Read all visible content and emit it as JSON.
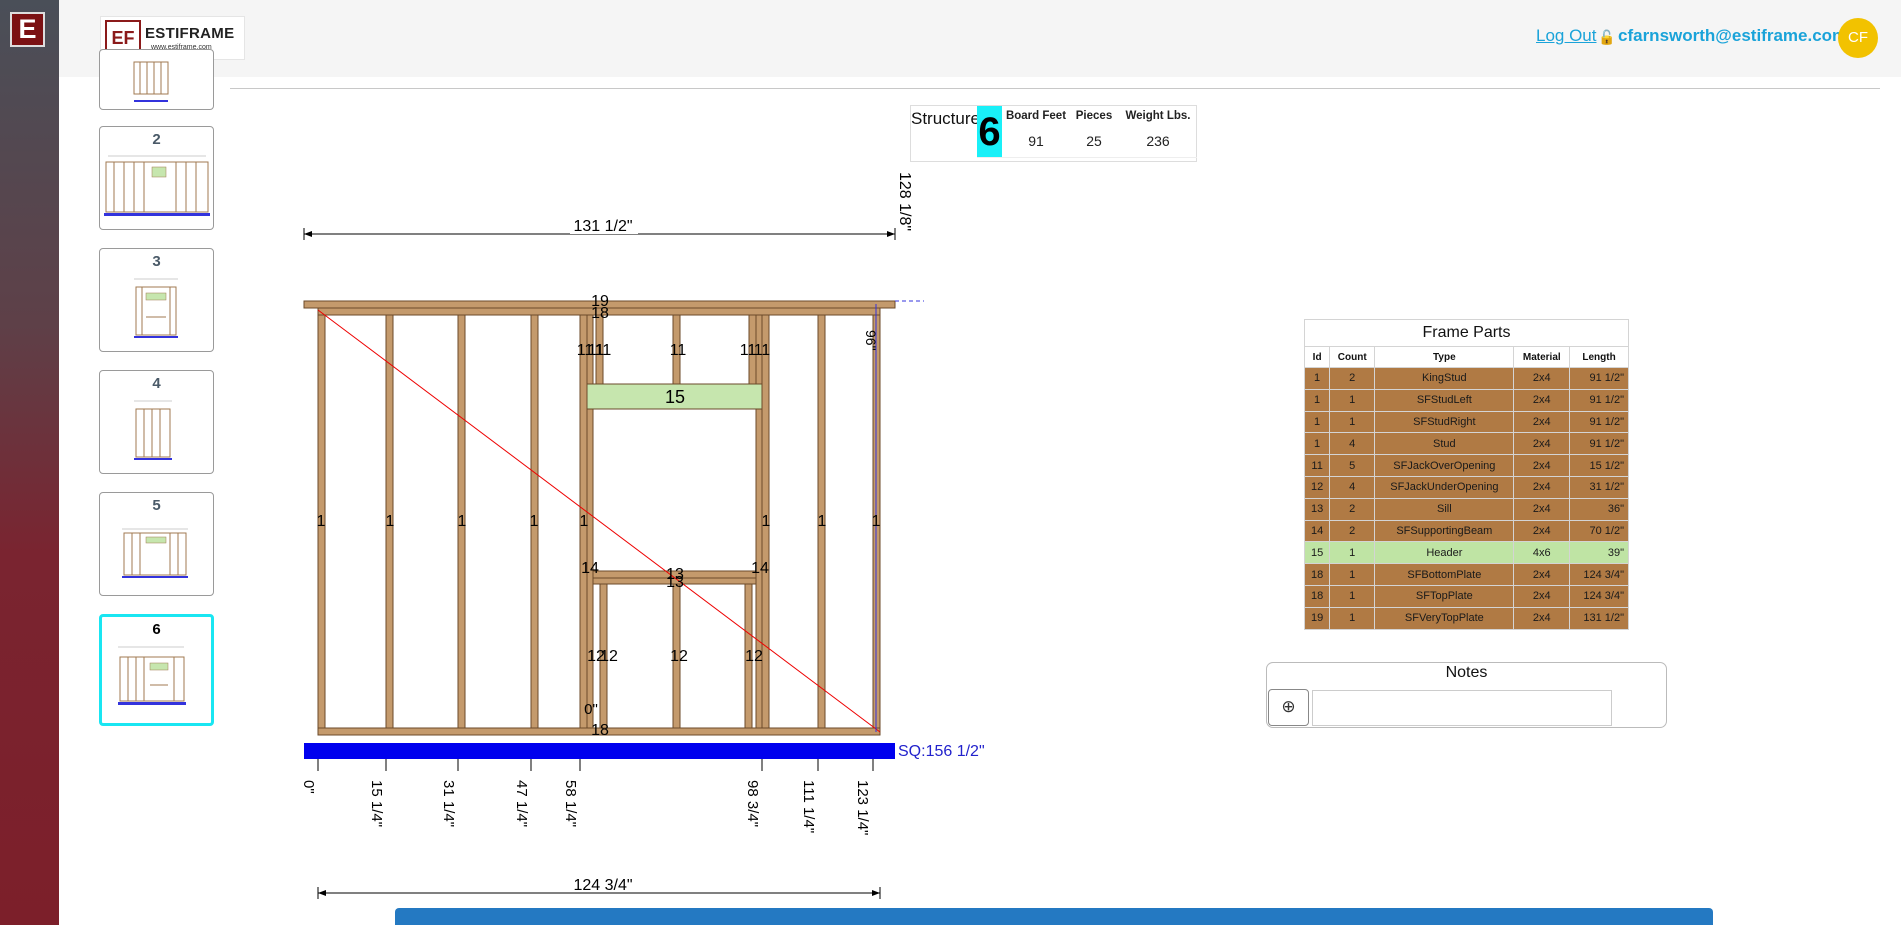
{
  "app": {
    "badge_letter": "E"
  },
  "header": {
    "logo_mark": "EF",
    "logo_name": "ESTIFRAME",
    "logo_url": "www.estiframe.com",
    "logout_label": "Log Out",
    "user_email": "cfarnsworth@estiframe.com",
    "avatar_initials": "CF"
  },
  "thumbnails": [
    {
      "label": "",
      "active": false
    },
    {
      "label": "2",
      "active": false
    },
    {
      "label": "3",
      "active": false
    },
    {
      "label": "4",
      "active": false
    },
    {
      "label": "5",
      "active": false
    },
    {
      "label": "6",
      "active": true
    }
  ],
  "structure": {
    "label": "Structure",
    "number": "6",
    "stats": [
      {
        "label": "Board Feet",
        "value": "91"
      },
      {
        "label": "Pieces",
        "value": "25"
      },
      {
        "label": "Weight Lbs.",
        "value": "236"
      }
    ]
  },
  "drawing": {
    "overall_width": "131 1/2\"",
    "overall_height": "128 1/8\"",
    "wall_height": "96\"",
    "plate_width": "124 3/4\"",
    "sq_label": "SQ:156 1/2\"",
    "zero_label": "0\"",
    "stud_positions": [
      "0\"",
      "15 1/4\"",
      "31 1/4\"",
      "47 1/4\"",
      "58 1/4\"",
      "98 3/4\"",
      "111 1/4\"",
      "123 1/4\""
    ],
    "stud_ids": [
      "1",
      "1",
      "1",
      "1",
      "1",
      "1",
      "1",
      "1"
    ],
    "top_ids": [
      "19",
      "18",
      "11",
      "11",
      "11",
      "11",
      "11",
      "11"
    ],
    "header_id": "15",
    "sill_ids": [
      "14",
      "13",
      "13",
      "14"
    ],
    "lower_ids": [
      "12",
      "12",
      "12",
      "12"
    ],
    "bottom_id": "18"
  },
  "frame_parts": {
    "title": "Frame Parts",
    "columns": [
      "Id",
      "Count",
      "Type",
      "Material",
      "Length"
    ],
    "rows": [
      [
        "1",
        "2",
        "KingStud",
        "2x4",
        "91 1/2\""
      ],
      [
        "1",
        "1",
        "SFStudLeft",
        "2x4",
        "91 1/2\""
      ],
      [
        "1",
        "1",
        "SFStudRight",
        "2x4",
        "91 1/2\""
      ],
      [
        "1",
        "4",
        "Stud",
        "2x4",
        "91 1/2\""
      ],
      [
        "11",
        "5",
        "SFJackOverOpening",
        "2x4",
        "15 1/2\""
      ],
      [
        "12",
        "4",
        "SFJackUnderOpening",
        "2x4",
        "31 1/2\""
      ],
      [
        "13",
        "2",
        "Sill",
        "2x4",
        "36\""
      ],
      [
        "14",
        "2",
        "SFSupportingBeam",
        "2x4",
        "70 1/2\""
      ],
      [
        "15",
        "1",
        "Header",
        "4x6",
        "39\""
      ],
      [
        "18",
        "1",
        "SFBottomPlate",
        "2x4",
        "124 3/4\""
      ],
      [
        "18",
        "1",
        "SFTopPlate",
        "2x4",
        "124 3/4\""
      ],
      [
        "19",
        "1",
        "SFVeryTopPlate",
        "2x4",
        "131 1/2\""
      ]
    ],
    "highlight_row": 8
  },
  "notes": {
    "title": "Notes",
    "add_icon": "add-circle-icon",
    "placeholder": ""
  },
  "colors": {
    "lumber": "#c49a6c",
    "lumber_edge": "#6b4a2a",
    "header_fill": "#c6e6ae",
    "bottom_bar": "#0000ee",
    "diagonal": "#ee0000",
    "accent": "#19e6f2",
    "link": "#1aa3d9"
  }
}
